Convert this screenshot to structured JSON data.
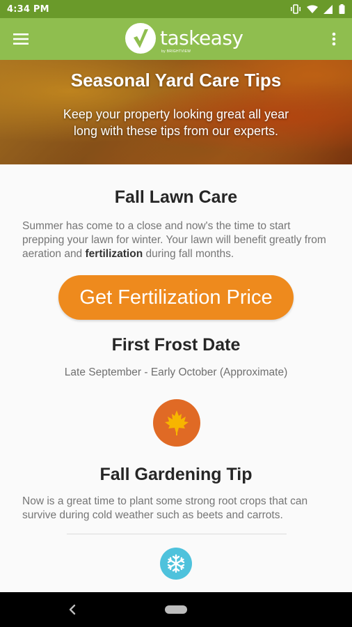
{
  "status_bar": {
    "time": "4:34 PM"
  },
  "app_bar": {
    "logo_text": "taskeasy",
    "logo_subtext": "by BRIGHTVIEW"
  },
  "hero": {
    "title": "Seasonal Yard Care Tips",
    "subtitle": "Keep your property looking great all year long with these tips from our experts."
  },
  "fall_lawn_care": {
    "title": "Fall Lawn Care",
    "text_before": "Summer has come to a close and now's the time to start prepping your lawn for winter. Your lawn will benefit greatly from aeration and ",
    "text_bold": "fertilization",
    "text_after": " during fall months.",
    "button_label": "Get Fertilization Price"
  },
  "first_frost": {
    "title": "First Frost Date",
    "text": "Late September - Early October (Approximate)"
  },
  "fall_gardening": {
    "title": "Fall Gardening Tip",
    "text": "Now is a great time to plant some strong root crops that can survive during cold weather such as beets and carrots."
  },
  "colors": {
    "status_bar": "#6a9a2a",
    "app_bar": "#8fbe4f",
    "cta": "#ee8a1d",
    "leaf_circle": "#e06a25",
    "snow_circle": "#4ec2dc"
  },
  "icons": [
    "menu-icon",
    "more-vert-icon",
    "maple-leaf-icon",
    "snowflake-icon",
    "back-icon",
    "home-icon"
  ]
}
